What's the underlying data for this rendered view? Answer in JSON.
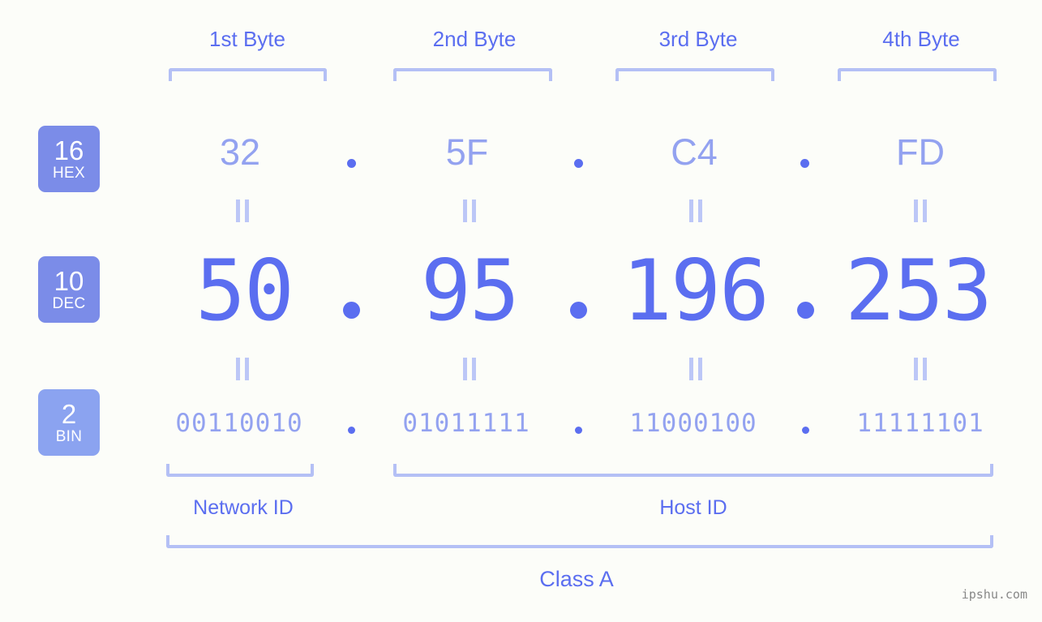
{
  "background_color": "#fcfdf9",
  "accent_color": "#5b6ef0",
  "accent_light_color": "#93a2f0",
  "bracket_color": "#b4c0f5",
  "badge_color": "#7b8ce8",
  "badge_light_color": "#8ba3f0",
  "header": {
    "bytes": [
      {
        "label": "1st Byte"
      },
      {
        "label": "2nd Byte"
      },
      {
        "label": "3rd Byte"
      },
      {
        "label": "4th Byte"
      }
    ]
  },
  "rows": {
    "hex": {
      "badge_number": "16",
      "badge_abbr": "HEX",
      "values": [
        "32",
        "5F",
        "C4",
        "FD"
      ],
      "separator": "."
    },
    "dec": {
      "badge_number": "10",
      "badge_abbr": "DEC",
      "values": [
        "50",
        "95",
        "196",
        "253"
      ],
      "separator": "."
    },
    "bin": {
      "badge_number": "2",
      "badge_abbr": "BIN",
      "values": [
        "00110010",
        "01011111",
        "11000100",
        "11111101"
      ],
      "separator": "."
    }
  },
  "equals_marks": {
    "glyph": "||",
    "count_per_row": 4
  },
  "footer": {
    "network_id_label": "Network ID",
    "host_id_label": "Host ID",
    "class_label": "Class A",
    "watermark": "ipshu.com"
  }
}
